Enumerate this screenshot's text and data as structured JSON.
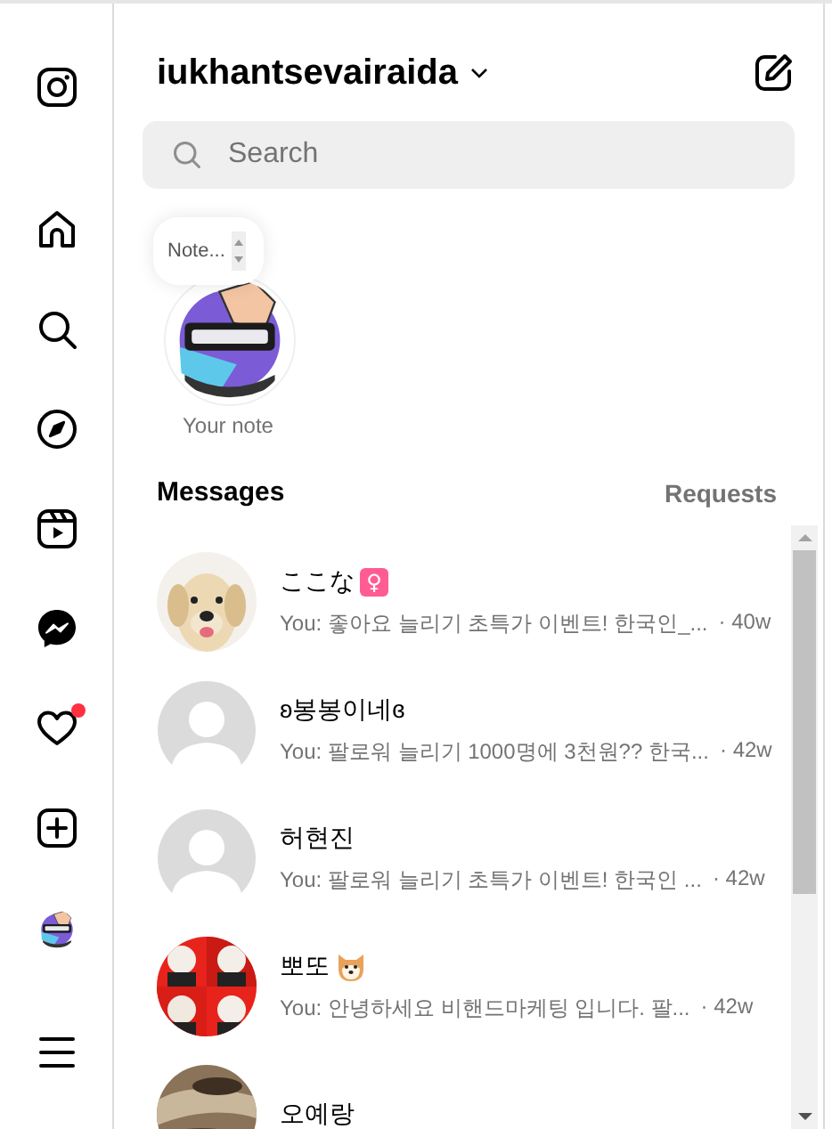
{
  "nav": [
    {
      "kind": "logo"
    },
    {
      "kind": "home"
    },
    {
      "kind": "search"
    },
    {
      "kind": "explore"
    },
    {
      "kind": "reels"
    },
    {
      "kind": "messenger"
    },
    {
      "kind": "heart",
      "badge": true
    },
    {
      "kind": "create"
    },
    {
      "kind": "profile"
    },
    {
      "kind": "menu"
    }
  ],
  "header": {
    "username": "iukhantsevairaida"
  },
  "search": {
    "placeholder": "Search"
  },
  "note": {
    "bubble": "Note...",
    "label": "Your note"
  },
  "messages": {
    "title": "Messages",
    "requests": "Requests",
    "threads": [
      {
        "name": "ここな",
        "badge": "♀",
        "preview": "You: 좋아요 늘리기 초특가 이벤트! 한국인_...",
        "time": "· 40w"
      },
      {
        "name": "ʚ봉봉이네ɞ",
        "avatar": {
          "kind": "default"
        },
        "preview": "You: 팔로워 늘리기 1000명에 3천원?? 한국...",
        "time": "· 42w"
      },
      {
        "name": "허현진",
        "avatar": {
          "kind": "default"
        },
        "preview": "You: 팔로워 늘리기 초특가 이벤트! 한국인 ...",
        "time": "· 42w"
      },
      {
        "name": "뽀또",
        "emoji": {
          "kind": "dog"
        },
        "preview": "You: 안녕하세요 비핸드마케팅 입니다. 팔...",
        "time": "· 42w"
      },
      {
        "name": "오예랑"
      }
    ]
  }
}
